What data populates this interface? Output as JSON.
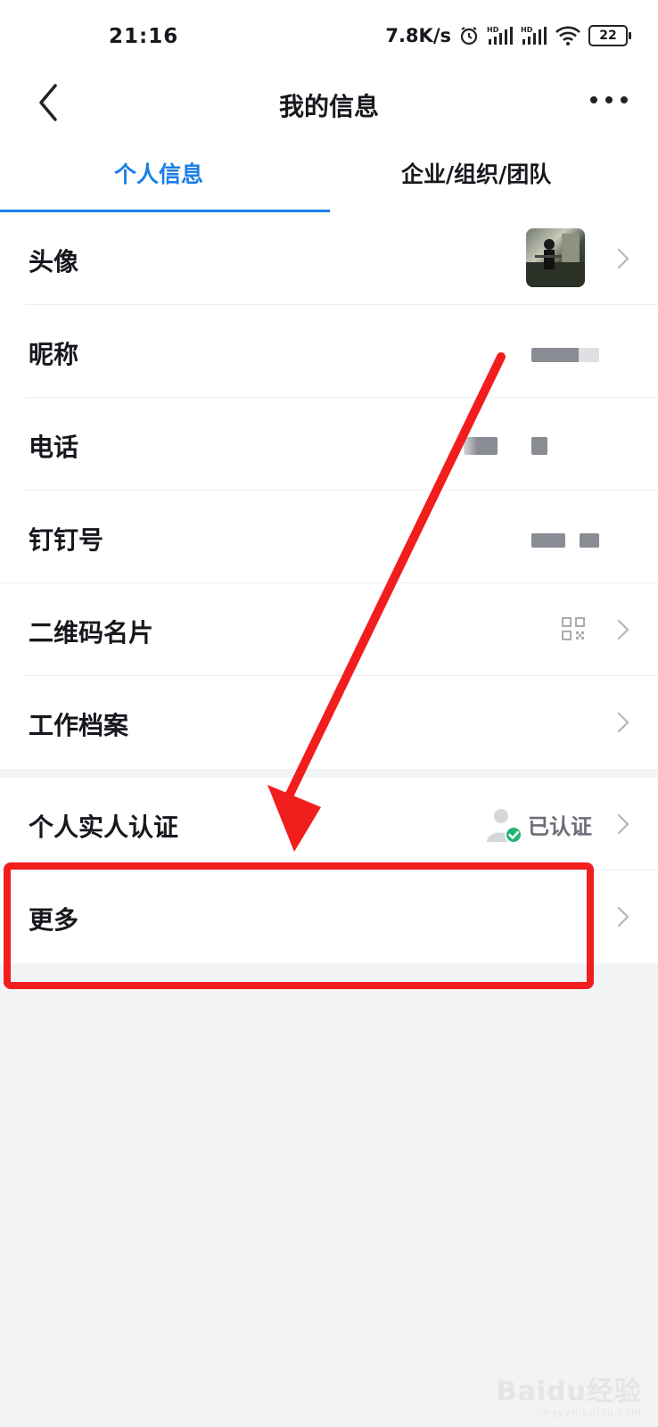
{
  "status_bar": {
    "time": "21:16",
    "net_speed": "7.8K/s",
    "signal_label_1": "HD",
    "signal_label_2": "HD",
    "battery": "22"
  },
  "header": {
    "title": "我的信息",
    "back_icon": "chevron-left-icon",
    "more_icon": "more-horizontal-icon"
  },
  "tabs": [
    {
      "label": "个人信息",
      "active": true
    },
    {
      "label": "企业/组织/团队",
      "active": false
    }
  ],
  "section1": [
    {
      "label": "头像"
    },
    {
      "label": "昵称"
    },
    {
      "label": "电话"
    },
    {
      "label": "钉钉号"
    },
    {
      "label": "二维码名片"
    },
    {
      "label": "工作档案"
    }
  ],
  "section2": [
    {
      "label": "个人实人认证",
      "value": "已认证"
    },
    {
      "label": "更多"
    }
  ],
  "colors": {
    "accent": "#1a7fe6",
    "annotation": "#f21d1d",
    "verified": "#22b573"
  },
  "watermark": {
    "text": "Baidu经验",
    "sub": "jingyan.baidu.com"
  }
}
